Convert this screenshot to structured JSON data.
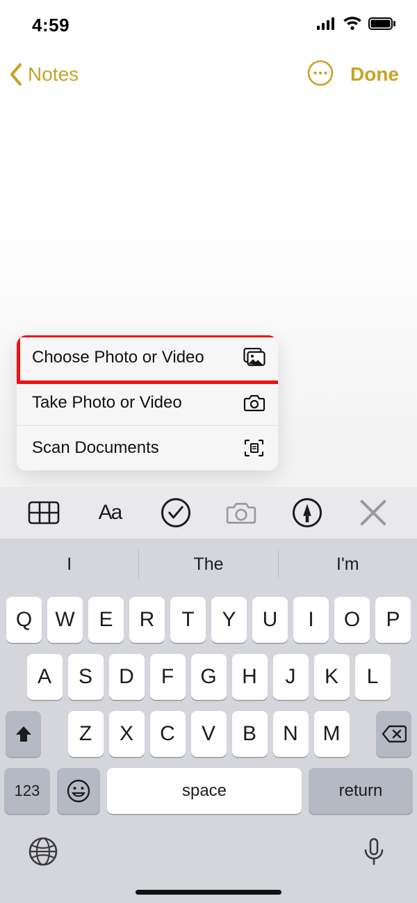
{
  "statusbar": {
    "time": "4:59"
  },
  "navbar": {
    "back_label": "Notes",
    "done_label": "Done"
  },
  "menu": {
    "items": [
      {
        "label": "Choose Photo or Video"
      },
      {
        "label": "Take Photo or Video"
      },
      {
        "label": "Scan Documents"
      }
    ]
  },
  "predictive": {
    "left": "I",
    "center": "The",
    "right": "I'm"
  },
  "keyboard": {
    "row1": [
      "Q",
      "W",
      "E",
      "R",
      "T",
      "Y",
      "U",
      "I",
      "O",
      "P"
    ],
    "row2": [
      "A",
      "S",
      "D",
      "F",
      "G",
      "H",
      "J",
      "K",
      "L"
    ],
    "row3": [
      "Z",
      "X",
      "C",
      "V",
      "B",
      "N",
      "M"
    ],
    "numbers_label": "123",
    "space_label": "space",
    "return_label": "return"
  }
}
